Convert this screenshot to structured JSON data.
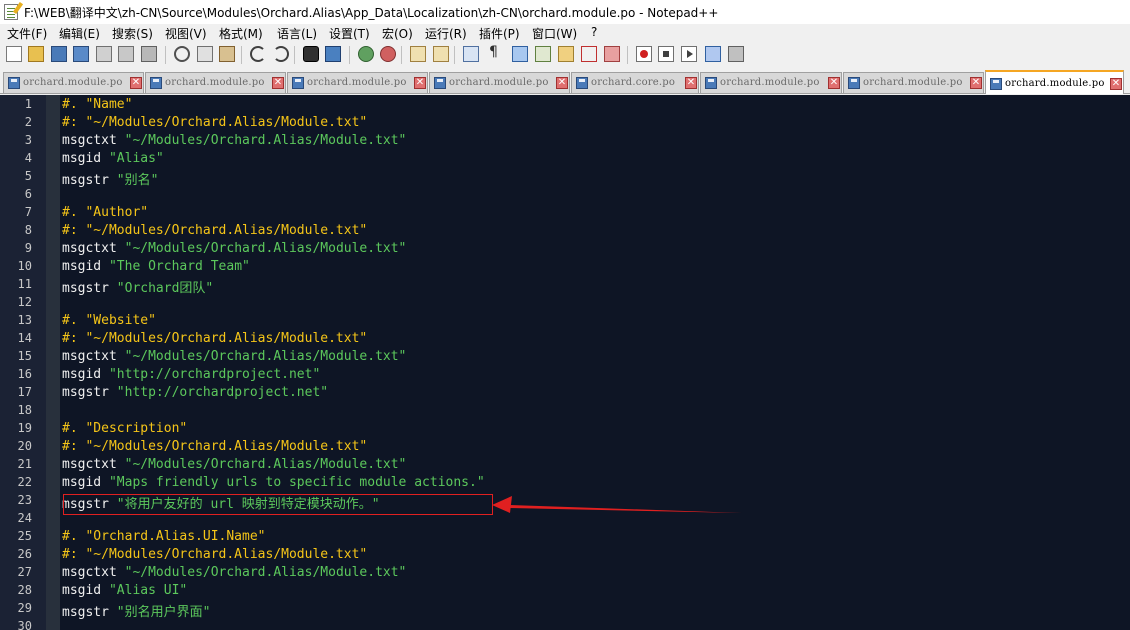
{
  "window": {
    "title": "F:\\WEB\\翻译中文\\zh-CN\\Source\\Modules\\Orchard.Alias\\App_Data\\Localization\\zh-CN\\orchard.module.po - Notepad++"
  },
  "menu": [
    {
      "label": "文件(F)",
      "name": "menu-file"
    },
    {
      "label": "编辑(E)",
      "name": "menu-edit"
    },
    {
      "label": "搜索(S)",
      "name": "menu-search"
    },
    {
      "label": "视图(V)",
      "name": "menu-view"
    },
    {
      "label": "格式(M)",
      "name": "menu-format"
    },
    {
      "label": "语言(L)",
      "name": "menu-language"
    },
    {
      "label": "设置(T)",
      "name": "menu-settings"
    },
    {
      "label": "宏(O)",
      "name": "menu-macro"
    },
    {
      "label": "运行(R)",
      "name": "menu-run"
    },
    {
      "label": "插件(P)",
      "name": "menu-plugins"
    },
    {
      "label": "窗口(W)",
      "name": "menu-window"
    },
    {
      "label": "?",
      "name": "menu-help"
    }
  ],
  "toolbar": [
    "new-file-icon",
    "open-file-icon",
    "save-icon",
    "save-all-icon",
    "close-icon",
    "close-all-icon",
    "print-icon",
    "cut-icon",
    "copy-icon",
    "paste-icon",
    "undo-icon",
    "redo-icon",
    "find-icon",
    "replace-icon",
    "zoom-in-icon",
    "zoom-out-icon",
    "sync-vertical-icon",
    "sync-horizontal-icon",
    "word-wrap-icon",
    "show-all-chars-icon",
    "indent-guide-icon",
    "document-map-icon",
    "function-list-icon",
    "folder-workspace-icon",
    "monitoring-icon",
    "record-macro-icon",
    "stop-macro-icon",
    "play-macro-icon",
    "play-multiple-macro-icon",
    "save-macro-icon"
  ],
  "tabs": [
    {
      "label": "orchard.module.po",
      "active": false
    },
    {
      "label": "orchard.module.po",
      "active": false
    },
    {
      "label": "orchard.module.po",
      "active": false
    },
    {
      "label": "orchard.module.po",
      "active": false
    },
    {
      "label": "orchard.core.po",
      "active": false
    },
    {
      "label": "orchard.module.po",
      "active": false
    },
    {
      "label": "orchard.module.po",
      "active": false
    },
    {
      "label": "orchard.module.po",
      "active": true
    }
  ],
  "tab_close_glyph": "✕",
  "colors": {
    "editor_bg": "#0e1525",
    "comment": "#f5c518",
    "keyword": "#f0f0f0",
    "string": "#5cc85c",
    "annotation": "#e02020"
  },
  "lines": [
    {
      "n": "1",
      "parts": [
        [
          "comment",
          "#. \"Name\""
        ]
      ]
    },
    {
      "n": "2",
      "parts": [
        [
          "comment",
          "#: \"~/Modules/Orchard.Alias/Module.txt\""
        ]
      ]
    },
    {
      "n": "3",
      "parts": [
        [
          "key",
          "msgctxt "
        ],
        [
          "str",
          "\"~/Modules/Orchard.Alias/Module.txt\""
        ]
      ]
    },
    {
      "n": "4",
      "parts": [
        [
          "key",
          "msgid "
        ],
        [
          "str",
          "\"Alias\""
        ]
      ]
    },
    {
      "n": "5",
      "parts": [
        [
          "key",
          "msgstr "
        ],
        [
          "str",
          "\"别名\""
        ]
      ]
    },
    {
      "n": "6",
      "parts": []
    },
    {
      "n": "7",
      "parts": [
        [
          "comment",
          "#. \"Author\""
        ]
      ]
    },
    {
      "n": "8",
      "parts": [
        [
          "comment",
          "#: \"~/Modules/Orchard.Alias/Module.txt\""
        ]
      ]
    },
    {
      "n": "9",
      "parts": [
        [
          "key",
          "msgctxt "
        ],
        [
          "str",
          "\"~/Modules/Orchard.Alias/Module.txt\""
        ]
      ]
    },
    {
      "n": "10",
      "parts": [
        [
          "key",
          "msgid "
        ],
        [
          "str",
          "\"The Orchard Team\""
        ]
      ]
    },
    {
      "n": "11",
      "parts": [
        [
          "key",
          "msgstr "
        ],
        [
          "str",
          "\"Orchard团队\""
        ]
      ]
    },
    {
      "n": "12",
      "parts": []
    },
    {
      "n": "13",
      "parts": [
        [
          "comment",
          "#. \"Website\""
        ]
      ]
    },
    {
      "n": "14",
      "parts": [
        [
          "comment",
          "#: \"~/Modules/Orchard.Alias/Module.txt\""
        ]
      ]
    },
    {
      "n": "15",
      "parts": [
        [
          "key",
          "msgctxt "
        ],
        [
          "str",
          "\"~/Modules/Orchard.Alias/Module.txt\""
        ]
      ]
    },
    {
      "n": "16",
      "parts": [
        [
          "key",
          "msgid "
        ],
        [
          "str",
          "\"http://orchardproject.net\""
        ]
      ]
    },
    {
      "n": "17",
      "parts": [
        [
          "key",
          "msgstr "
        ],
        [
          "str",
          "\"http://orchardproject.net\""
        ]
      ]
    },
    {
      "n": "18",
      "parts": []
    },
    {
      "n": "19",
      "parts": [
        [
          "comment",
          "#. \"Description\""
        ]
      ]
    },
    {
      "n": "20",
      "parts": [
        [
          "comment",
          "#: \"~/Modules/Orchard.Alias/Module.txt\""
        ]
      ]
    },
    {
      "n": "21",
      "parts": [
        [
          "key",
          "msgctxt "
        ],
        [
          "str",
          "\"~/Modules/Orchard.Alias/Module.txt\""
        ]
      ]
    },
    {
      "n": "22",
      "parts": [
        [
          "key",
          "msgid "
        ],
        [
          "str",
          "\"Maps friendly urls to specific module actions.\""
        ]
      ]
    },
    {
      "n": "23",
      "parts": [
        [
          "key",
          "msgstr "
        ],
        [
          "str",
          "\"将用户友好的 url 映射到特定模块动作。\""
        ]
      ]
    },
    {
      "n": "24",
      "parts": []
    },
    {
      "n": "25",
      "parts": [
        [
          "comment",
          "#. \"Orchard.Alias.UI.Name\""
        ]
      ]
    },
    {
      "n": "26",
      "parts": [
        [
          "comment",
          "#: \"~/Modules/Orchard.Alias/Module.txt\""
        ]
      ]
    },
    {
      "n": "27",
      "parts": [
        [
          "key",
          "msgctxt "
        ],
        [
          "str",
          "\"~/Modules/Orchard.Alias/Module.txt\""
        ]
      ]
    },
    {
      "n": "28",
      "parts": [
        [
          "key",
          "msgid "
        ],
        [
          "str",
          "\"Alias UI\""
        ]
      ]
    },
    {
      "n": "29",
      "parts": [
        [
          "key",
          "msgstr "
        ],
        [
          "str",
          "\"别名用户界面\""
        ]
      ]
    },
    {
      "n": "30",
      "parts": []
    }
  ]
}
